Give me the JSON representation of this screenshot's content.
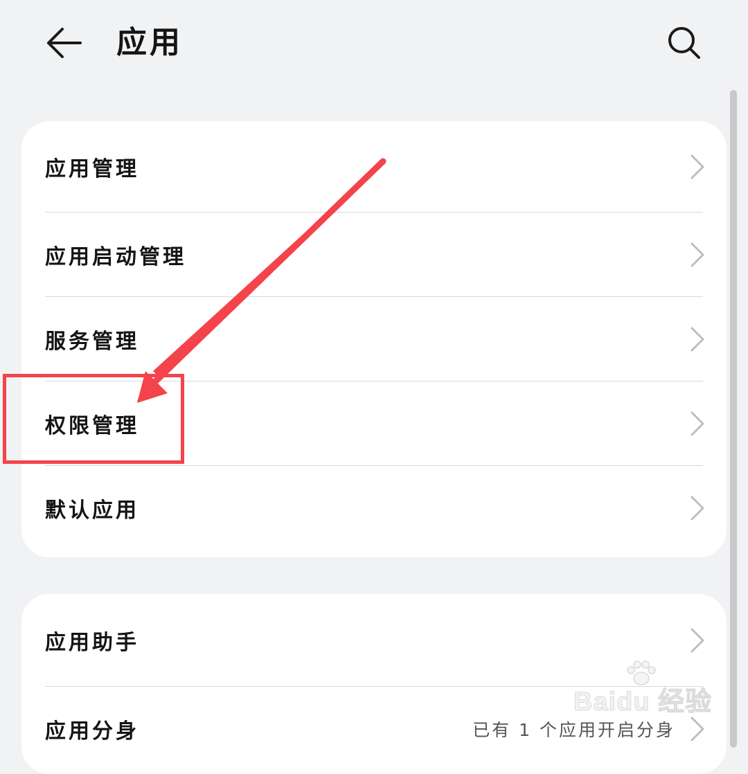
{
  "header": {
    "title": "应用"
  },
  "sections": [
    {
      "items": [
        {
          "label": "应用管理"
        },
        {
          "label": "应用启动管理"
        },
        {
          "label": "服务管理"
        },
        {
          "label": "权限管理"
        },
        {
          "label": "默认应用"
        }
      ]
    },
    {
      "items": [
        {
          "label": "应用助手"
        },
        {
          "label": "应用分身",
          "value": "已有 1 个应用开启分身"
        }
      ]
    }
  ],
  "watermark": {
    "text": "Baidu 经验"
  },
  "colors": {
    "background": "#f1f2f4",
    "card": "#ffffff",
    "annotation": "#f4434a",
    "chevron": "#bdbdbd"
  },
  "icons": {
    "back": "back-arrow-icon",
    "search": "search-icon",
    "chevron": "chevron-right-icon"
  }
}
